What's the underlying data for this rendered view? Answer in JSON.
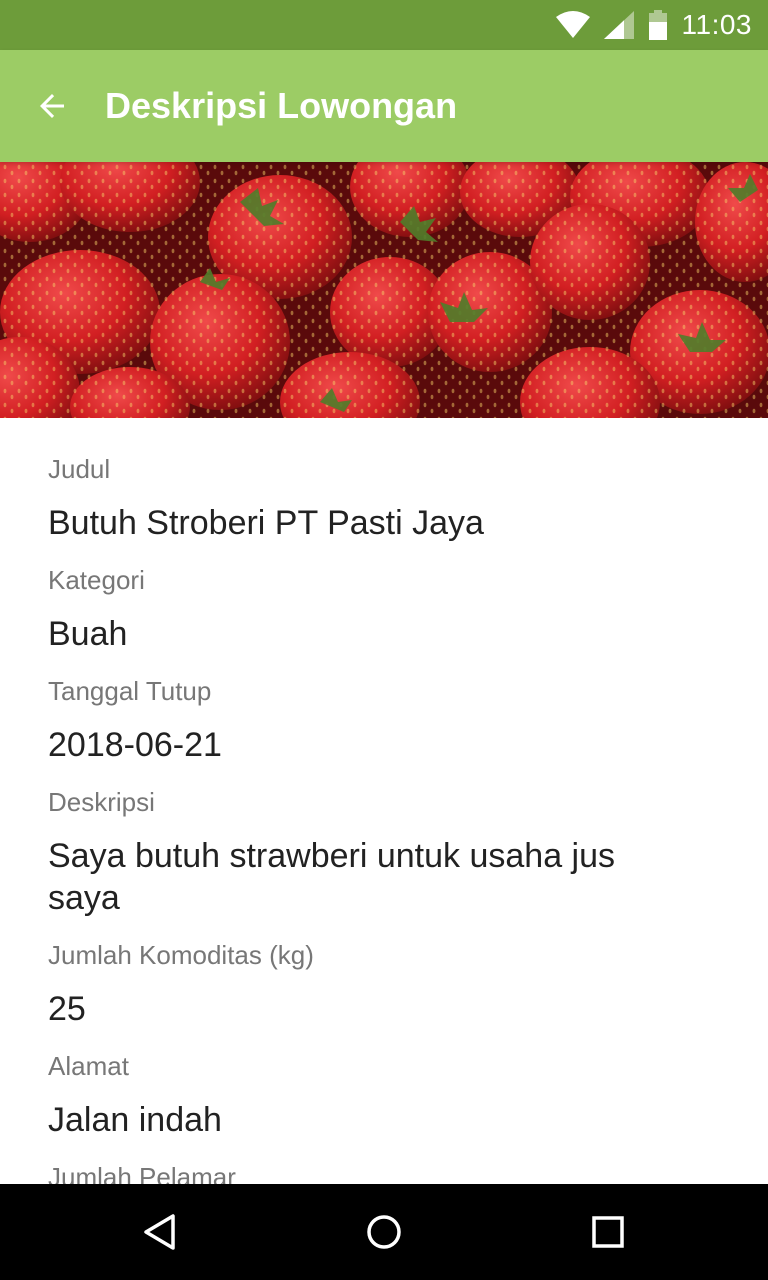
{
  "status_bar": {
    "time": "11:03",
    "background": "#6d9c3a"
  },
  "toolbar": {
    "title": "Deskripsi Lowongan",
    "background": "#9ccc65",
    "back_icon": "arrow-back-icon"
  },
  "banner": {
    "image": "strawberries-photo"
  },
  "details": {
    "judul": {
      "label": "Judul",
      "value": "Butuh Stroberi PT Pasti Jaya"
    },
    "kategori": {
      "label": "Kategori",
      "value": "Buah"
    },
    "tanggal_tutup": {
      "label": "Tanggal Tutup",
      "value": "2018-06-21"
    },
    "deskripsi": {
      "label": "Deskripsi",
      "value": "Saya butuh strawberi untuk usaha jus saya"
    },
    "jumlah_komoditas": {
      "label": "Jumlah Komoditas (kg)",
      "value": "25"
    },
    "alamat": {
      "label": "Alamat",
      "value": "Jalan indah"
    },
    "jumlah_pelamar": {
      "label": "Jumlah Pelamar"
    }
  },
  "nav_bar": {
    "back_icon": "triangle-back-icon",
    "home_icon": "circle-home-icon",
    "recents_icon": "square-recents-icon"
  }
}
